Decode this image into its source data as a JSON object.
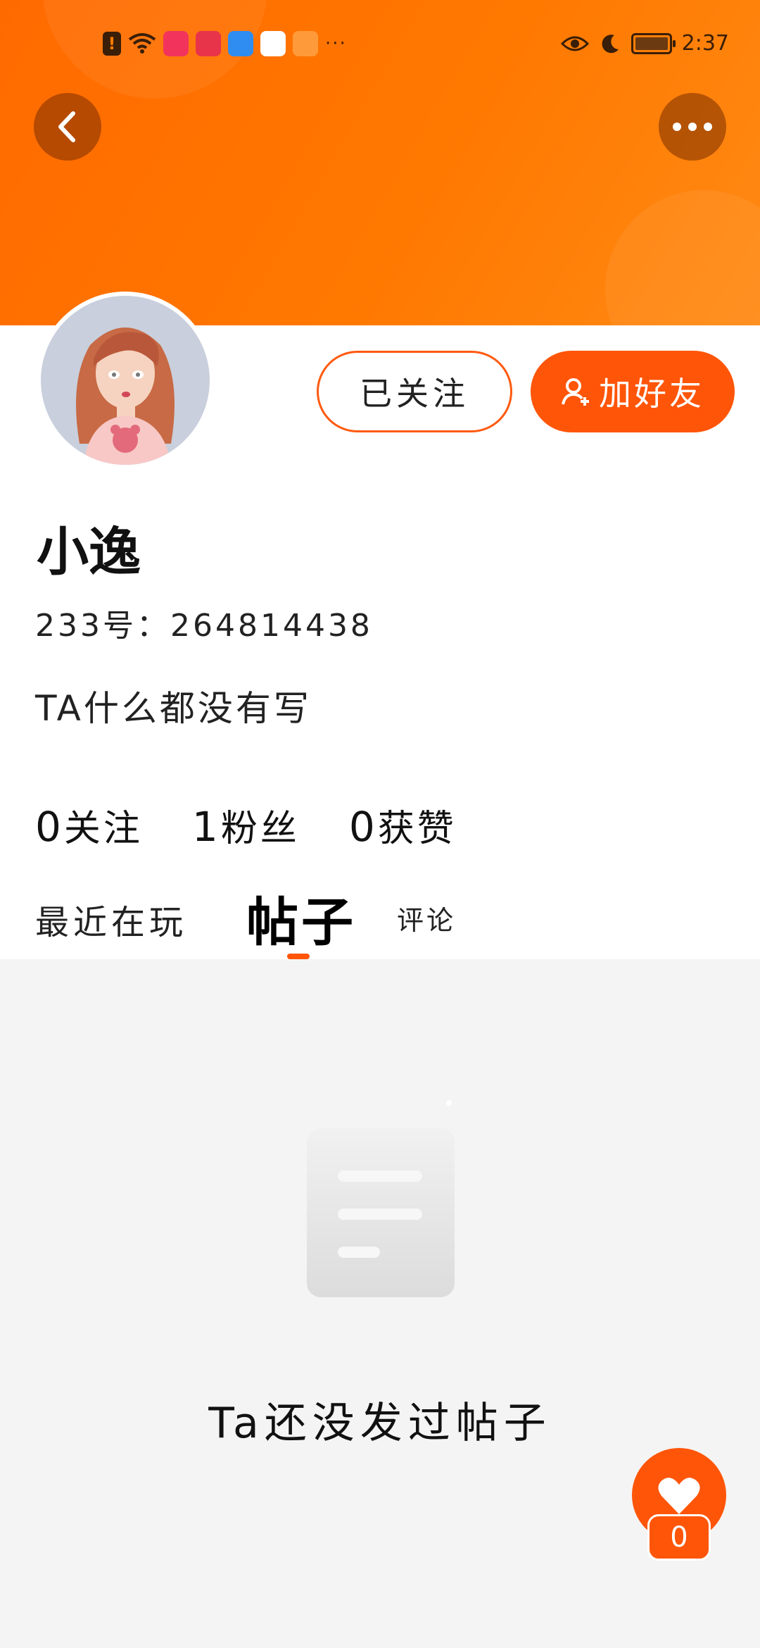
{
  "status_bar": {
    "time": "2:37",
    "more_indicator": "···",
    "icons": [
      "alert-icon",
      "wifi-icon",
      "book-app-icon",
      "huawei-store-icon",
      "cloud-app-icon",
      "browser-app-icon",
      "video-app-icon",
      "eye-icon",
      "moon-icon",
      "battery-icon"
    ]
  },
  "header": {
    "back_icon": "chevron-left-icon",
    "more_icon": "more-dots-icon"
  },
  "profile": {
    "nickname": "小逸",
    "uid": "233号：264814438",
    "bio": "TA什么都没有写",
    "follow_label": "已关注",
    "add_friend_label": "加好友",
    "stats": [
      {
        "num": "0",
        "label": "关注"
      },
      {
        "num": "1",
        "label": "粉丝"
      },
      {
        "num": "0",
        "label": "获赞"
      }
    ]
  },
  "tabs": {
    "recent": "最近在玩",
    "posts": "帖子",
    "comments": "评论",
    "active": "posts"
  },
  "empty_state": {
    "message": "Ta还没发过帖子"
  },
  "like_fab": {
    "count": "0"
  },
  "colors": {
    "accent": "#ff5508",
    "banner": "#ff7800"
  }
}
